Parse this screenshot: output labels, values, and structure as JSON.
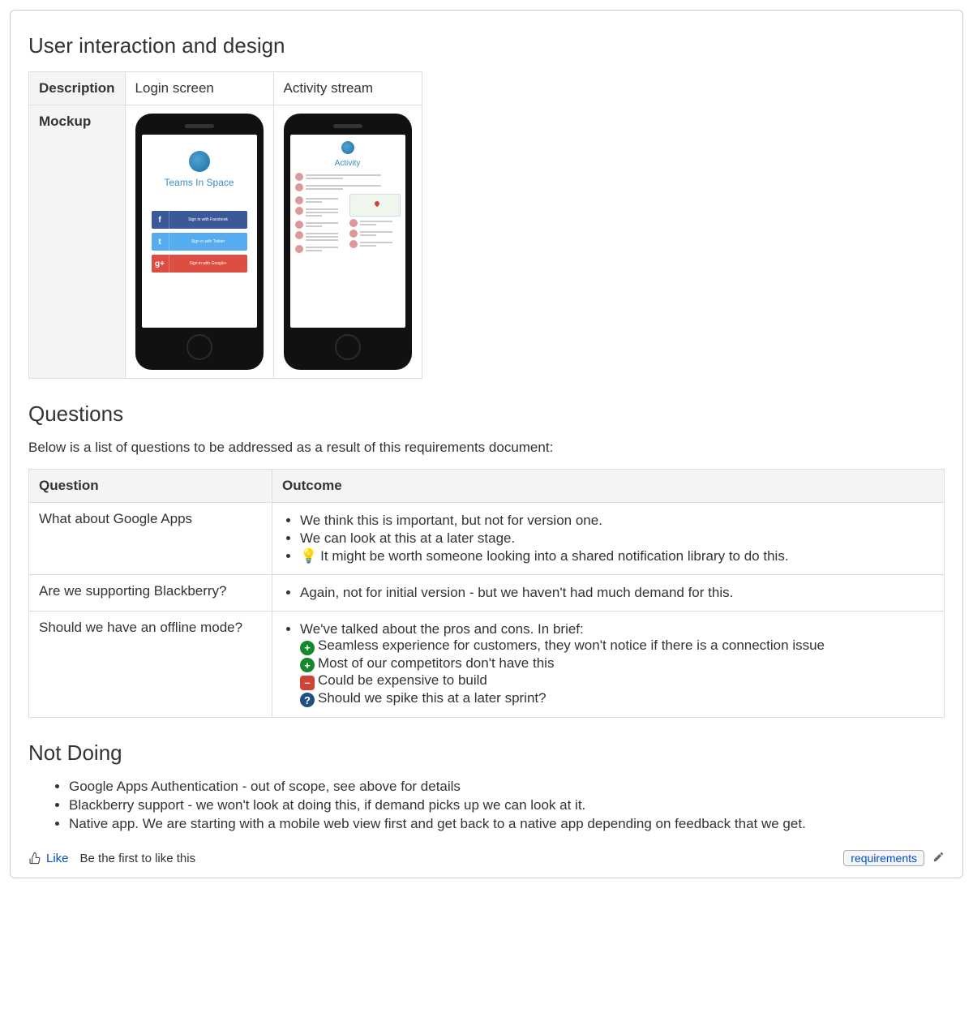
{
  "section_design_heading": "User interaction and design",
  "mockup_table": {
    "row_labels": [
      "Description",
      "Mockup"
    ],
    "columns": [
      "Login screen",
      "Activity stream"
    ],
    "login_mockup": {
      "brand": "Teams In Space",
      "buttons": [
        {
          "provider": "Facebook",
          "label": "Sign in with Facebook"
        },
        {
          "provider": "Twitter",
          "label": "Sign in with Twitter"
        },
        {
          "provider": "Google+",
          "label": "Sign in with Google+"
        }
      ]
    },
    "activity_mockup": {
      "title": "Activity"
    }
  },
  "section_questions_heading": "Questions",
  "questions_intro": "Below is a list of questions to be addressed as a result of this requirements document:",
  "questions_table": {
    "headers": [
      "Question",
      "Outcome"
    ],
    "rows": [
      {
        "question": "What about Google Apps",
        "outcome": [
          {
            "type": "plain",
            "text": "We think this is important, but not for version one."
          },
          {
            "type": "plain",
            "text": "We can look at this at a later stage."
          },
          {
            "type": "bulb",
            "text": "It might be worth someone looking into a shared notification library to do this."
          }
        ]
      },
      {
        "question": "Are we supporting Blackberry?",
        "outcome": [
          {
            "type": "plain",
            "text": "Again, not for initial version - but we haven't had much demand for this."
          }
        ]
      },
      {
        "question": "Should we have an offline mode?",
        "outcome_intro": "We've talked about the pros and cons. In brief:",
        "sub": [
          {
            "icon": "plus",
            "text": "Seamless experience for customers, they won't notice if there is a connection issue"
          },
          {
            "icon": "plus",
            "text": "Most of our competitors don't have this"
          },
          {
            "icon": "minus",
            "text": "Could be expensive to build"
          },
          {
            "icon": "question",
            "text": "Should we spike this at a later sprint?"
          }
        ]
      }
    ]
  },
  "section_notdoing_heading": "Not Doing",
  "not_doing": [
    "Google Apps Authentication - out of scope, see above for details",
    "Blackberry support - we won't look at doing this, if demand picks up we can look at it.",
    "Native app. We are starting with a mobile web view first and get back to a native app depending on feedback that we get."
  ],
  "footer": {
    "like_label": "Like",
    "first_like_text": "Be the first to like this",
    "tag": "requirements"
  }
}
